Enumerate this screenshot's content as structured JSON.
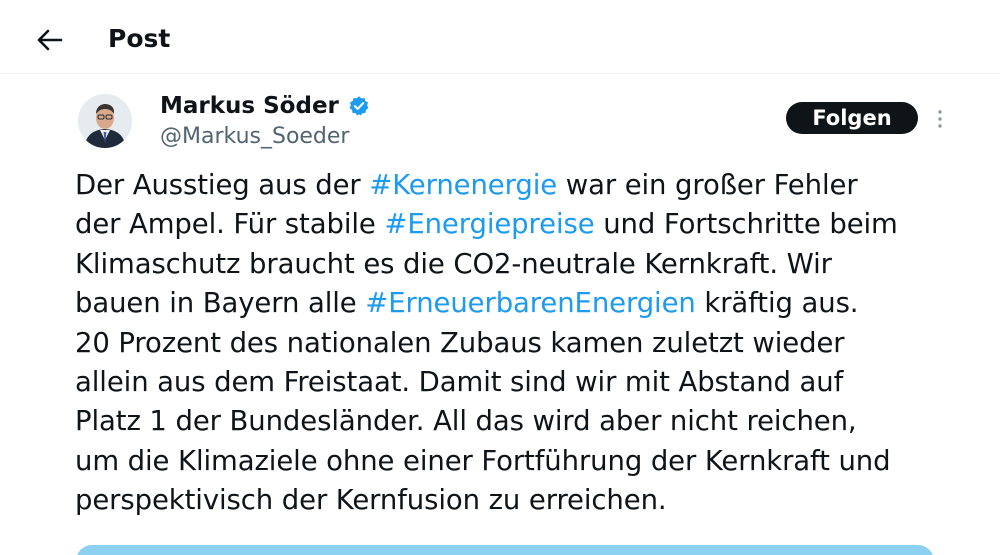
{
  "header": {
    "title": "Post"
  },
  "author": {
    "name": "Markus Söder",
    "handle": "@Markus_Soeder",
    "verified": true
  },
  "follow_label": "Folgen",
  "tweet": {
    "lines": [
      [
        {
          "t": "Der Ausstieg aus der "
        },
        {
          "t": "#Kernenergie",
          "tag": true
        },
        {
          "t": " war ein großer Fehler"
        }
      ],
      [
        {
          "t": "der Ampel. Für stabile "
        },
        {
          "t": "#Energiepreise",
          "tag": true
        },
        {
          "t": " und Fortschritte beim"
        }
      ],
      [
        {
          "t": "Klimaschutz braucht es die CO2-neutrale Kernkraft. Wir"
        }
      ],
      [
        {
          "t": "bauen in Bayern alle "
        },
        {
          "t": "#ErneuerbarenEnergien",
          "tag": true
        },
        {
          "t": " kräftig aus."
        }
      ],
      [
        {
          "t": "20 Prozent des nationalen Zubaus kamen zuletzt wieder"
        }
      ],
      [
        {
          "t": "allein aus dem Freistaat. Damit sind wir mit Abstand auf"
        }
      ],
      [
        {
          "t": "Platz 1 der Bundesländer. All das wird aber nicht reichen,"
        }
      ],
      [
        {
          "t": "um die Klimaziele ohne einer Fortführung der Kernkraft und"
        }
      ],
      [
        {
          "t": "perspektivisch der Kernfusion zu erreichen."
        }
      ]
    ]
  },
  "icons": {
    "back": "arrow-left-icon",
    "verified": "verified-badge-icon",
    "more": "more-vertical-icon"
  },
  "colors": {
    "hashtag": "#1d9bf0",
    "follow_button_bg": "#0f1419",
    "verified": "#1d9bf0",
    "media_peek": "#8cd2f0"
  }
}
